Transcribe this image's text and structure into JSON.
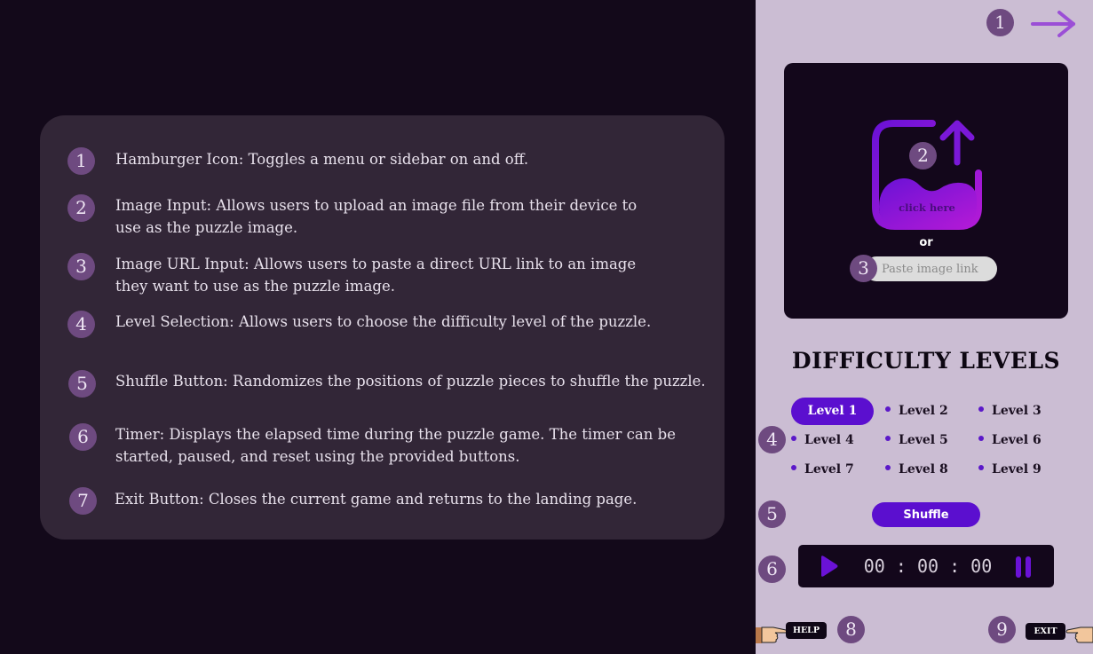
{
  "info_panel": {
    "items": [
      {
        "num": "1",
        "text": "Hamburger Icon: Toggles a menu or sidebar on and off."
      },
      {
        "num": "2",
        "text": "Image Input: Allows users to upload an image file from their device to use as the puzzle image."
      },
      {
        "num": "3",
        "text": "Image URL Input: Allows users to paste a direct URL link to an image they want to use as the puzzle image."
      },
      {
        "num": "4",
        "text": "Level Selection: Allows users to choose the difficulty level of the puzzle."
      },
      {
        "num": "5",
        "text": "Shuffle Button: Randomizes the positions of puzzle pieces to shuffle the puzzle."
      },
      {
        "num": "6",
        "text": "Timer: Displays the elapsed time during the puzzle game. The timer can be started, paused, and reset using the provided buttons."
      },
      {
        "num": "7",
        "text": "Exit Button: Closes the current game and returns to the landing page."
      }
    ]
  },
  "sidebar": {
    "markers": {
      "m1": "1",
      "m2": "2",
      "m3": "3",
      "m4": "4",
      "m5": "5",
      "m6": "6",
      "m8": "8",
      "m9": "9"
    },
    "upload": {
      "click_label": "click here",
      "or_label": "or",
      "url_placeholder": "Paste image link"
    },
    "difficulty_title": "DIFFICULTY LEVELS",
    "levels": [
      "Level 1",
      "Level 2",
      "Level 3",
      "Level 4",
      "Level 5",
      "Level 6",
      "Level 7",
      "Level 8",
      "Level 9"
    ],
    "selected_level": "Level 1",
    "shuffle_label": "Shuffle",
    "timer": {
      "display": "00 : 00 : 00"
    },
    "help_label": "HELP",
    "exit_label": "EXIT"
  },
  "colors": {
    "accent": "#5b0fcf",
    "marker": "#6e4a80",
    "sidebar_bg": "#cbbdd3",
    "main_bg": "#13091a",
    "panel_bg": "#322637"
  },
  "icons": [
    "arrow-right-icon",
    "image-upload-icon",
    "play-icon",
    "pause-icon",
    "pointing-hand-icon"
  ]
}
